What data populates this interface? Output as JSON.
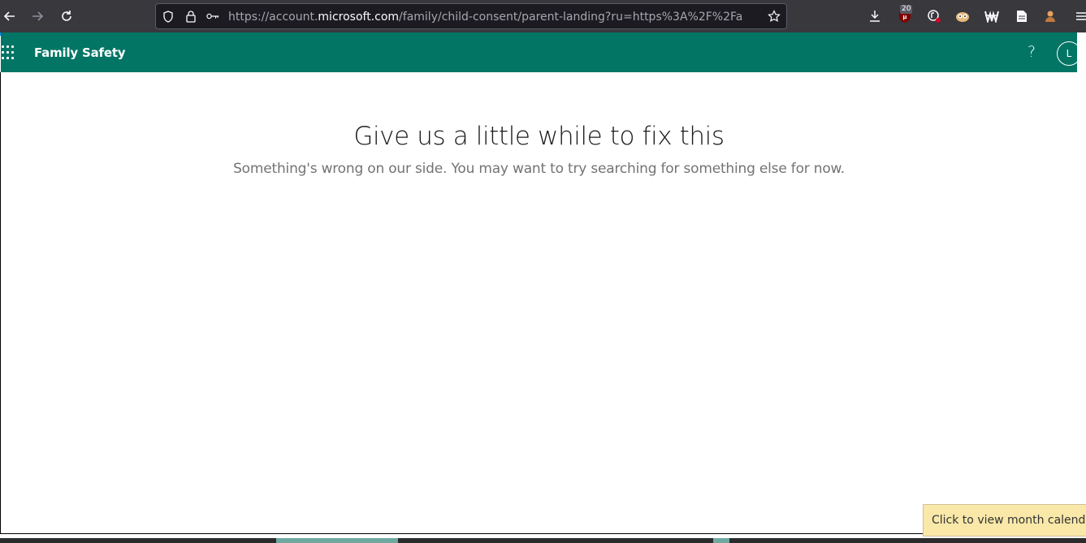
{
  "browser": {
    "url_prefix": "https://account.",
    "url_host": "microsoft.com",
    "url_path": "/family/child-consent/parent-landing?ru=https%3A%2F%2Fa",
    "extension_badge": "20",
    "icons": {
      "back": "arrow-left-icon",
      "forward": "arrow-right-icon",
      "reload": "reload-icon",
      "shield": "shield-icon",
      "lock": "lock-icon",
      "key": "key-icon",
      "bookmark": "star-icon",
      "downloads": "download-icon",
      "menu": "hamburger-icon"
    }
  },
  "app": {
    "title": "Family Safety",
    "help_label": "?",
    "avatar_initial": "L",
    "header_color": "#027565"
  },
  "error": {
    "title": "Give us a little while to fix this",
    "message": "Something's wrong on our side. You may want to try searching for something else for now."
  },
  "tooltip": {
    "text": "Click to view month calendar"
  }
}
